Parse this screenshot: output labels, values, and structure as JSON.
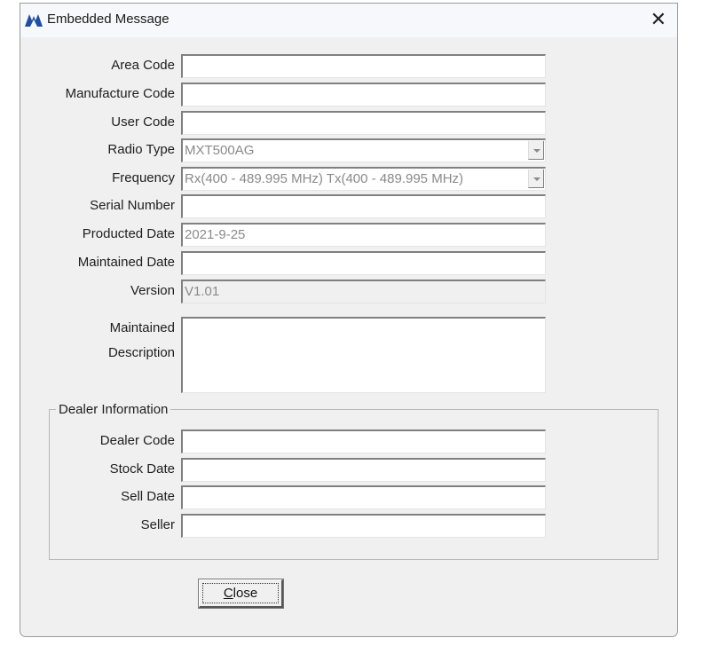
{
  "window": {
    "title": "Embedded Message",
    "close_glyph": "✕"
  },
  "fields": [
    {
      "label": "Area Code",
      "value": ""
    },
    {
      "label": "Manufacture Code",
      "value": ""
    },
    {
      "label": "User Code",
      "value": ""
    },
    {
      "label": "Radio Type",
      "value": "MXT500AG"
    },
    {
      "label": "Frequency",
      "value": "Rx(400 - 489.995 MHz) Tx(400 - 489.995 MHz)"
    },
    {
      "label": "Serial Number",
      "value": ""
    },
    {
      "label": "Producted Date",
      "value": "2021-9-25"
    },
    {
      "label": "Maintained Date",
      "value": ""
    },
    {
      "label": "Version",
      "value": "V1.01"
    }
  ],
  "description": {
    "label_line1": "Maintained",
    "label_line2": "Description",
    "value": ""
  },
  "dealer": {
    "title": "Dealer Information",
    "fields": [
      {
        "label": "Dealer Code",
        "value": ""
      },
      {
        "label": "Stock Date",
        "value": ""
      },
      {
        "label": "Sell Date",
        "value": ""
      },
      {
        "label": "Seller",
        "value": ""
      }
    ]
  },
  "buttons": {
    "close_mnemonic": "C",
    "close_rest": "lose"
  }
}
